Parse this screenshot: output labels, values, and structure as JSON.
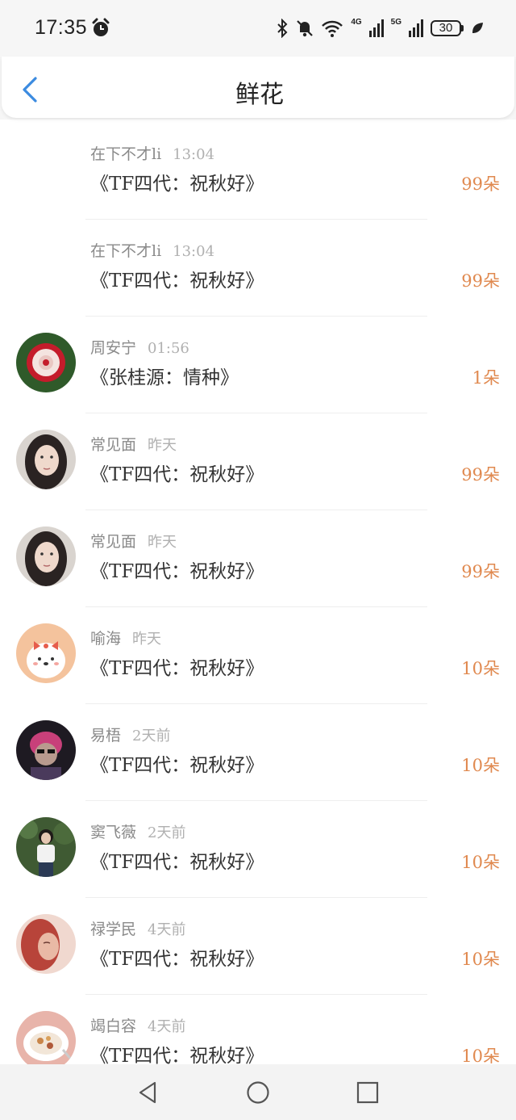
{
  "status": {
    "time": "17:35",
    "net1": "4G",
    "net2": "5G",
    "battery": "30"
  },
  "header": {
    "title": "鲜花"
  },
  "rows": [
    {
      "name": "在下不才li",
      "time": "13:04",
      "book": "《TF四代：祝秋好》",
      "count": "99朵",
      "avatar": "none"
    },
    {
      "name": "在下不才li",
      "time": "13:04",
      "book": "《TF四代：祝秋好》",
      "count": "99朵",
      "avatar": "none"
    },
    {
      "name": "周安宁",
      "time": "01:56",
      "book": "《张桂源：情种》",
      "count": "1朵",
      "avatar": "flower"
    },
    {
      "name": "常见面",
      "time": "昨天",
      "book": "《TF四代：祝秋好》",
      "count": "99朵",
      "avatar": "girl"
    },
    {
      "name": "常见面",
      "time": "昨天",
      "book": "《TF四代：祝秋好》",
      "count": "99朵",
      "avatar": "girl"
    },
    {
      "name": "喻海",
      "time": "昨天",
      "book": "《TF四代：祝秋好》",
      "count": "10朵",
      "avatar": "cartoon"
    },
    {
      "name": "易梧",
      "time": "2天前",
      "book": "《TF四代：祝秋好》",
      "count": "10朵",
      "avatar": "anime"
    },
    {
      "name": "窦飞薇",
      "time": "2天前",
      "book": "《TF四代：祝秋好》",
      "count": "10朵",
      "avatar": "person-green"
    },
    {
      "name": "禄学民",
      "time": "4天前",
      "book": "《TF四代：祝秋好》",
      "count": "10朵",
      "avatar": "redhair"
    },
    {
      "name": "竭白容",
      "time": "4天前",
      "book": "《TF四代：祝秋好》",
      "count": "10朵",
      "avatar": "food"
    }
  ],
  "colors": {
    "accent_blue": "#3b8be0",
    "count_orange": "#e0894f"
  }
}
